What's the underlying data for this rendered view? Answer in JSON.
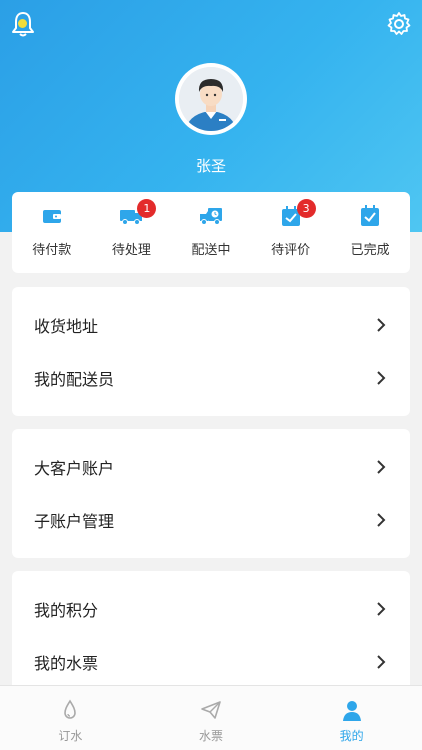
{
  "profile": {
    "name": "张圣"
  },
  "orders": [
    {
      "label": "待付款",
      "icon": "wallet-icon",
      "badge": ""
    },
    {
      "label": "待处理",
      "icon": "truck-icon",
      "badge": "1"
    },
    {
      "label": "配送中",
      "icon": "delivery-truck-icon",
      "badge": ""
    },
    {
      "label": "待评价",
      "icon": "calendar-check-icon",
      "badge": "3"
    },
    {
      "label": "已完成",
      "icon": "checkbox-icon",
      "badge": ""
    }
  ],
  "menu_groups": [
    {
      "items": [
        {
          "label": "收货地址"
        },
        {
          "label": "我的配送员"
        }
      ]
    },
    {
      "items": [
        {
          "label": "大客户账户"
        },
        {
          "label": "子账户管理"
        }
      ]
    },
    {
      "items": [
        {
          "label": "我的积分"
        },
        {
          "label": "我的水票"
        }
      ]
    }
  ],
  "tabs": [
    {
      "label": "订水",
      "icon": "water-drop-icon",
      "active": false
    },
    {
      "label": "水票",
      "icon": "paper-plane-icon",
      "active": false
    },
    {
      "label": "我的",
      "icon": "person-icon",
      "active": true
    }
  ],
  "colors": {
    "accent": "#2ea6ea",
    "badge": "#e32b2b",
    "header_start": "#2b9fe6",
    "header_end": "#4fc6f2"
  }
}
